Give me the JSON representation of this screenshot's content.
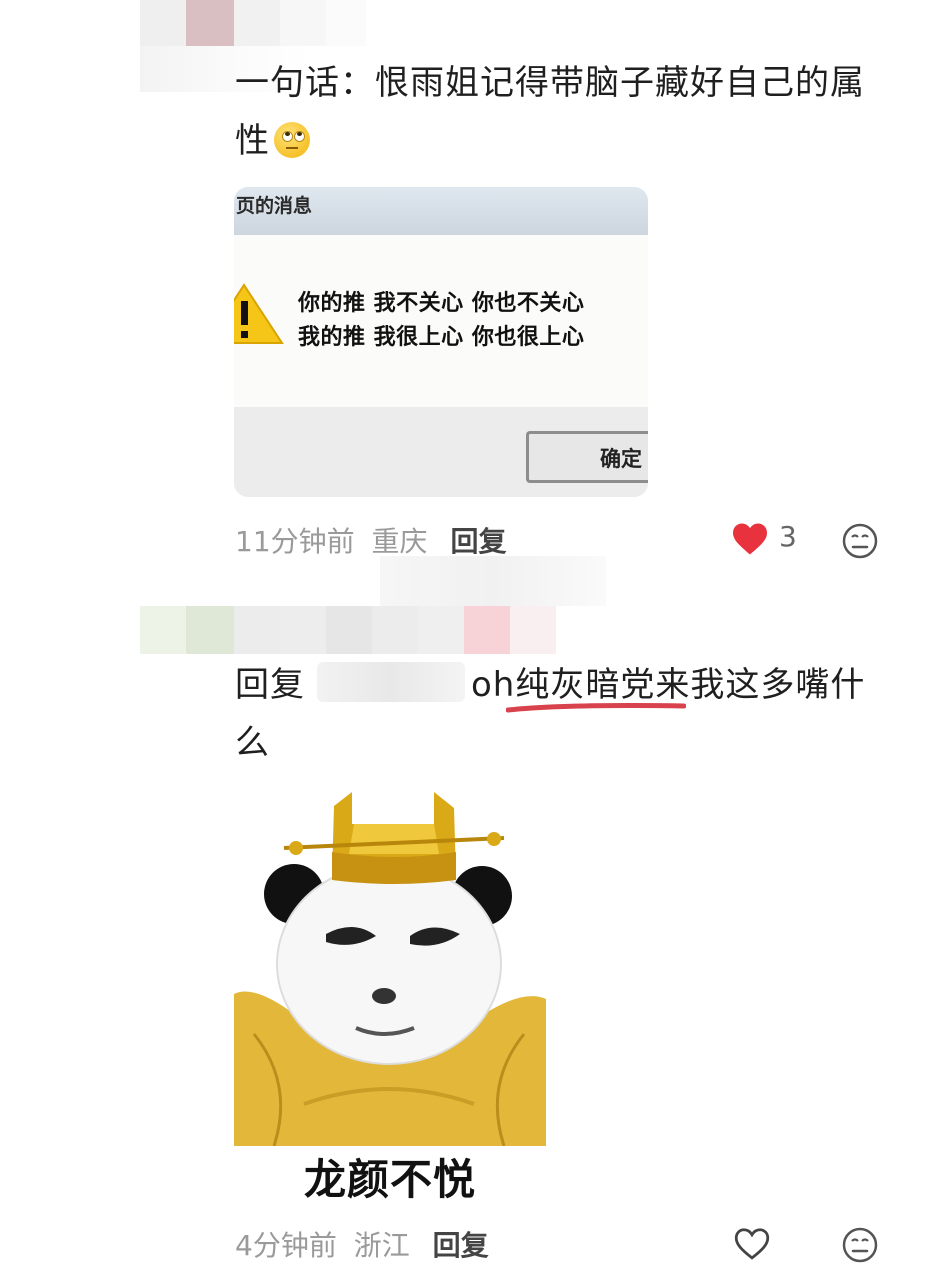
{
  "comments": [
    {
      "text": "一句话：恨雨姐记得带脑子藏好自己的属性",
      "emoji": "face-with-rolling-eyes",
      "meme": {
        "title": "页的消息",
        "line1": "你的推 我不关心 你也不关心",
        "line2": "我的推 我很上心 你也很上心",
        "button": "确定"
      },
      "time": "11分钟前",
      "location": "重庆",
      "reply_label": "回复",
      "likes": "3",
      "liked": true
    },
    {
      "reply_prefix": "回复",
      "text": "oh纯灰暗党来我这多嘴什么",
      "meme": {
        "caption": "龙颜不悦"
      },
      "time": "4分钟前",
      "location": "浙江",
      "reply_label": "回复",
      "liked": false
    }
  ],
  "colors": {
    "like_red": "#e8323e",
    "meta_gray": "#9a9a9a",
    "underline_red": "#d8424c"
  },
  "icons": [
    "heart-filled-icon",
    "heart-outline-icon",
    "emoji-reaction-icon",
    "warning-icon"
  ]
}
